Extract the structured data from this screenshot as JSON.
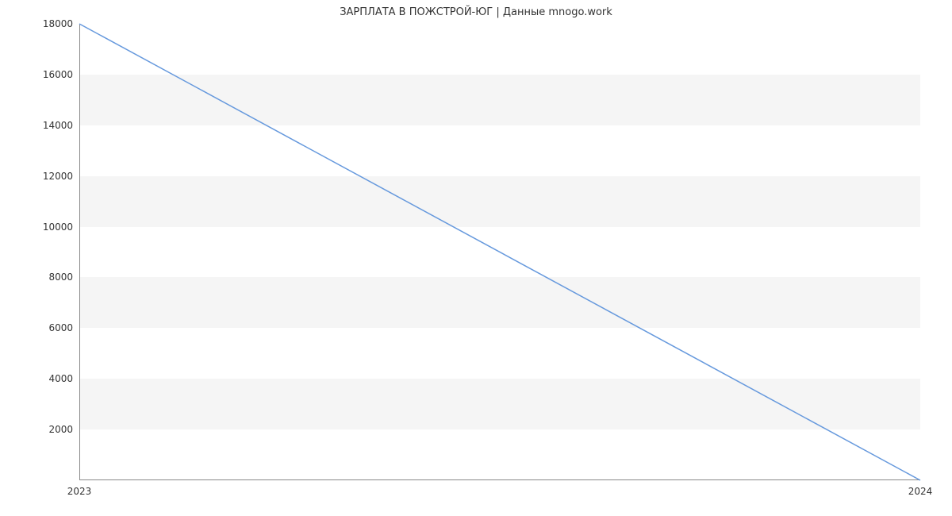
{
  "chart_data": {
    "type": "line",
    "title": "ЗАРПЛАТА В ПОЖСТРОЙ-ЮГ | Данные mnogo.work",
    "xlabel": "",
    "ylabel": "",
    "x": [
      2023,
      2024
    ],
    "values": [
      18000,
      0
    ],
    "x_ticks": [
      2023,
      2024
    ],
    "y_ticks": [
      2000,
      4000,
      6000,
      8000,
      10000,
      12000,
      14000,
      16000,
      18000
    ],
    "xlim": [
      2023,
      2024
    ],
    "ylim": [
      0,
      18000
    ],
    "bands": [
      [
        2000,
        4000
      ],
      [
        6000,
        8000
      ],
      [
        10000,
        12000
      ],
      [
        14000,
        16000
      ]
    ],
    "line_color": "#6699dd",
    "band_color": "#f5f5f5"
  }
}
